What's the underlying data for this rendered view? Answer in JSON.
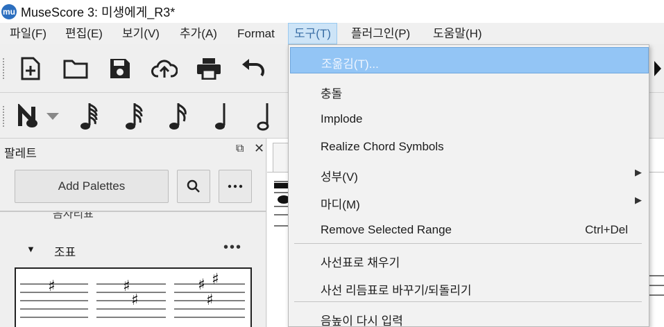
{
  "window": {
    "title": "MuseScore 3: 미생에게_R3*",
    "logo_text": "mu"
  },
  "menubar": {
    "items": [
      {
        "label": "파일(F)"
      },
      {
        "label": "편집(E)"
      },
      {
        "label": "보기(V)"
      },
      {
        "label": "추가(A)"
      },
      {
        "label": "Format"
      },
      {
        "label": "도구(T)"
      },
      {
        "label": "플러그인(P)"
      },
      {
        "label": "도움말(H)"
      }
    ]
  },
  "toolbar": {
    "icons": [
      "new-score-icon",
      "open-folder-icon",
      "save-icon",
      "upload-cloud-icon",
      "print-icon",
      "undo-icon"
    ]
  },
  "note_toolbar": {
    "icons": [
      "note-input-icon",
      "dropdown-icon",
      "64th-note-icon",
      "32nd-note-icon",
      "16th-note-icon",
      "eighth-note-icon",
      "quarter-note-icon",
      "half-note-icon"
    ]
  },
  "palette": {
    "title": "팔레트",
    "add_palettes": "Add Palettes",
    "partial_item": "음자리표",
    "section": {
      "label": "조표",
      "more": "•••"
    }
  },
  "tools_menu": {
    "items": [
      {
        "label": "조옮김(T)...",
        "shortcut": "",
        "submenu": false
      },
      {
        "label": "충돌",
        "shortcut": "",
        "submenu": false
      },
      {
        "label": "Implode",
        "shortcut": "",
        "submenu": false
      },
      {
        "label": "Realize Chord Symbols",
        "shortcut": "",
        "submenu": false
      },
      {
        "label": "성부(V)",
        "shortcut": "",
        "submenu": true
      },
      {
        "label": "마디(M)",
        "shortcut": "",
        "submenu": true
      },
      {
        "label": "Remove Selected Range",
        "shortcut": "Ctrl+Del",
        "submenu": false
      },
      {
        "label": "사선표로 채우기",
        "shortcut": "",
        "submenu": false
      },
      {
        "label": "사선 리듬표로 바꾸기/되돌리기",
        "shortcut": "",
        "submenu": false
      },
      {
        "label": "음높이 다시 입력",
        "shortcut": "",
        "submenu": false
      }
    ]
  },
  "colors": {
    "highlight": "#93c5f5",
    "active_menu": "#cde4f7",
    "logo": "#2c6fbf"
  }
}
